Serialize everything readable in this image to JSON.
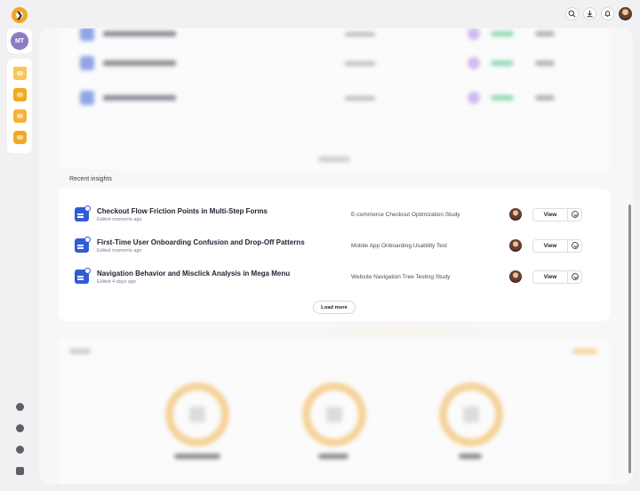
{
  "brand": {
    "logo_glyph": "❯",
    "accent": "#f5a623"
  },
  "user": {
    "initials": "MT"
  },
  "topbar": {
    "icons": [
      "search-icon",
      "download-icon",
      "bell-icon",
      "user-avatar"
    ]
  },
  "sidebar": {
    "icons": [
      "folder-heart-icon",
      "box-icon",
      "user-card-icon",
      "stack-icon"
    ],
    "bottom_icons": [
      "profile-icon",
      "settings-icon",
      "help-icon",
      "feedback-icon"
    ]
  },
  "insights": {
    "tab_label": "Recent insights",
    "rows": [
      {
        "title": "Checkout Flow Friction Points in Multi-Step Forms",
        "edited": "Edited moments ago",
        "study": "E-commerce Checkout Optimization Study",
        "view_label": "View"
      },
      {
        "title": "First-Time User Onboarding Confusion and Drop-Off Patterns",
        "edited": "Edited moments ago",
        "study": "Mobile App Onboarding Usability Test",
        "view_label": "View"
      },
      {
        "title": "Navigation Behavior and Misclick Analysis in Mega Menu",
        "edited": "Edited 4 days ago",
        "study": "Website Navigation Tree Testing Study",
        "view_label": "View"
      }
    ],
    "load_more_label": "Load more"
  }
}
